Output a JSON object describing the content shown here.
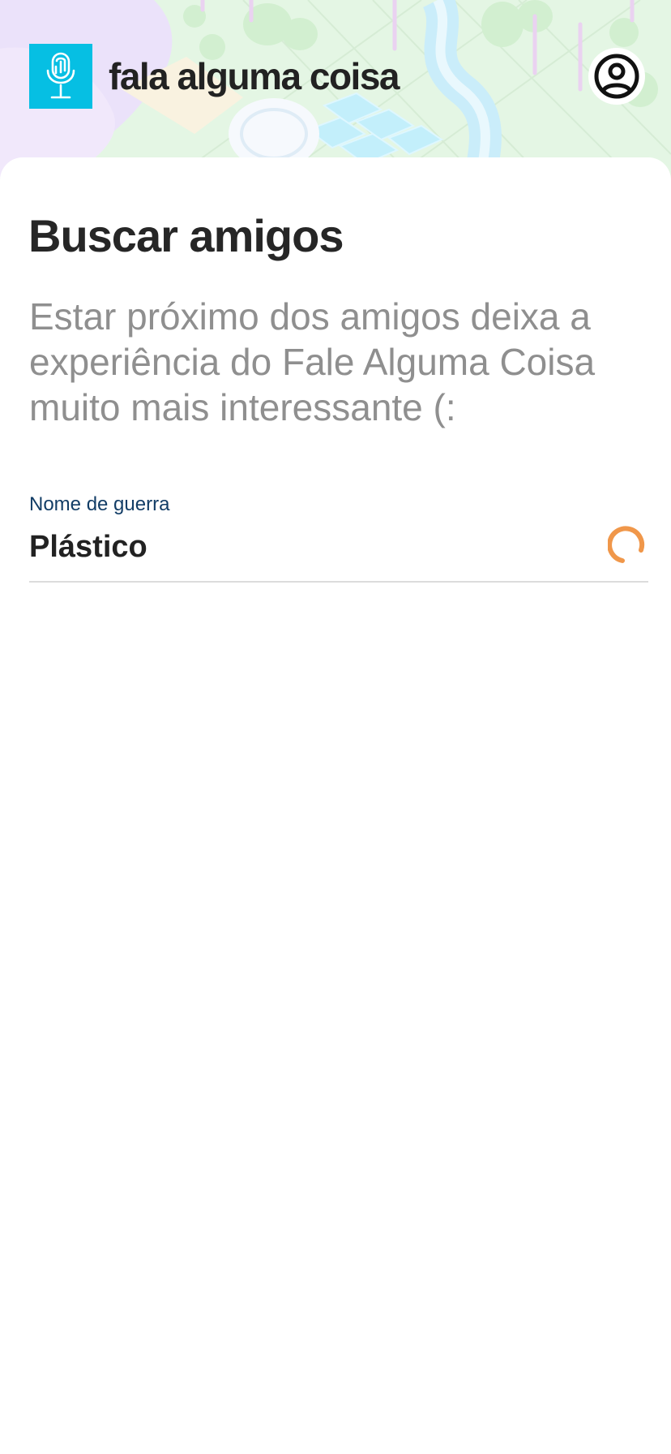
{
  "header": {
    "app_name": "fala alguma coisa",
    "logo_icon": "fingerprint-microphone-icon",
    "profile_icon": "user-circle-icon",
    "brand_color": "#06bfe3"
  },
  "main": {
    "title": "Buscar amigos",
    "subtitle": "Estar próximo dos amigos deixa a experiência do Fale Alguma Coisa muito mais interessante (:",
    "field": {
      "label": "Nome de guerra",
      "value": "Plástico",
      "status_icon": "loading-spinner-icon",
      "spinner_color": "#f0974a",
      "label_color": "#123d66"
    }
  }
}
